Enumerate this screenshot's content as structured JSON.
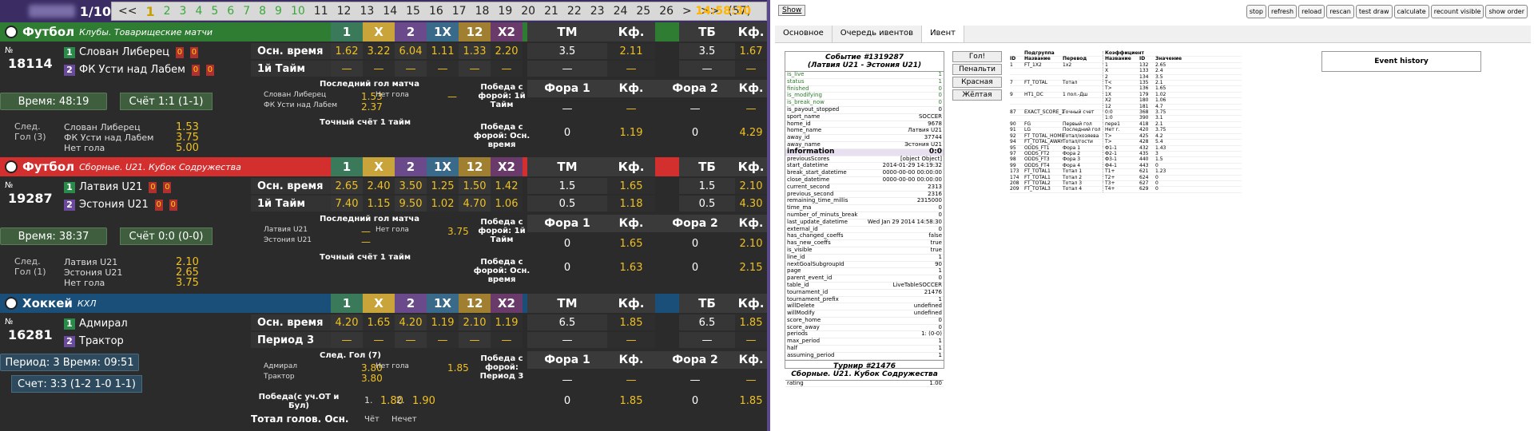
{
  "top": {
    "pager": "1/10",
    "pages": [
      "<<",
      "1",
      "2",
      "3",
      "4",
      "5",
      "6",
      "7",
      "8",
      "9",
      "10",
      "11",
      "12",
      "13",
      "14",
      "15",
      "16",
      "17",
      "18",
      "19",
      "20",
      "21",
      "22",
      "23",
      "24",
      "25",
      "26",
      ">",
      ">>",
      "(57)"
    ],
    "clock": "14:58:30"
  },
  "market_headers": [
    "1",
    "X",
    "2",
    "1X",
    "12",
    "X2",
    "ТМ",
    "Кф.",
    "ТБ",
    "Кф."
  ],
  "events": [
    {
      "sport": "Футбол",
      "league": "Клубы. Товарищеские матчи",
      "bar": "#2e7d32",
      "no": "№",
      "id": "18114",
      "team1": "Слован Либерец",
      "team2": "ФК Усти над Лабем",
      "time": "Время: 48:19",
      "score": "Счёт 1:1 (1-1)",
      "rows": [
        {
          "label": "Осн. время",
          "v": [
            "1.62",
            "3.22",
            "6.04",
            "1.11",
            "1.33",
            "2.20",
            "3.5",
            "2.11",
            "3.5",
            "1.67"
          ]
        },
        {
          "label": "1й Тайм",
          "v": [
            "—",
            "—",
            "—",
            "—",
            "—",
            "—",
            "—",
            "—",
            "—",
            "—"
          ]
        }
      ],
      "lastgoal": "Последний гол матча",
      "lg": [
        [
          "Слован Либерец",
          "1.53",
          "Нет гола",
          "—"
        ],
        [
          "ФК Усти над Лабем",
          "2.37",
          "",
          ""
        ]
      ],
      "exact": "Точный счёт 1 тайм",
      "win1": "Победа с форой: 1й Тайм",
      "win2": "Победа с форой: Осн. время",
      "fora": [
        "Фора 1",
        "Кф.",
        "Фора 2",
        "Кф."
      ],
      "f1": [
        "—",
        "—",
        "—",
        "—"
      ],
      "f2": [
        "0",
        "1.19",
        "0",
        "4.29"
      ],
      "next": "След. Гол (3)",
      "nx": [
        [
          "Слован Либерец",
          "1.53"
        ],
        [
          "ФК Усти над Лабем",
          "3.75"
        ],
        [
          "Нет гола",
          "5.00"
        ]
      ]
    },
    {
      "sport": "Футбол",
      "league": "Сборные. U21. Кубок Содружества",
      "bar": "#d32f2f",
      "no": "№",
      "id": "19287",
      "team1": "Латвия U21",
      "team2": "Эстония U21",
      "time": "Время: 38:37",
      "score": "Счёт 0:0 (0-0)",
      "rows": [
        {
          "label": "Осн. время",
          "v": [
            "2.65",
            "2.40",
            "3.50",
            "1.25",
            "1.50",
            "1.42",
            "1.5",
            "1.65",
            "1.5",
            "2.10"
          ]
        },
        {
          "label": "1й Тайм",
          "v": [
            "7.40",
            "1.15",
            "9.50",
            "1.02",
            "4.70",
            "1.06",
            "0.5",
            "1.18",
            "0.5",
            "4.30"
          ]
        }
      ],
      "lastgoal": "Последний гол матча",
      "lg": [
        [
          "Латвия U21",
          "—",
          "Нет гола",
          "3.75"
        ],
        [
          "Эстония U21",
          "—",
          "",
          ""
        ]
      ],
      "exact": "Точный счёт 1 тайм",
      "win1": "Победа с форой: 1й Тайм",
      "win2": "Победа с форой: Осн. время",
      "fora": [
        "Фора 1",
        "Кф.",
        "Фора 2",
        "Кф."
      ],
      "f1": [
        "0",
        "1.65",
        "0",
        "2.10"
      ],
      "f2": [
        "0",
        "1.63",
        "0",
        "2.15"
      ],
      "next": "След. Гол (1)",
      "nx": [
        [
          "Латвия U21",
          "2.10"
        ],
        [
          "Эстония U21",
          "2.65"
        ],
        [
          "Нет гола",
          "3.75"
        ]
      ]
    },
    {
      "sport": "Хоккей",
      "league": "КХЛ",
      "bar": "#1a4f7a",
      "no": "№",
      "id": "16281",
      "team1": "Адмирал",
      "team2": "Трактор",
      "time": "Период: 3 Время: 09:51",
      "score": "Счет: 3:3 (1-2 1-0 1-1)",
      "rows": [
        {
          "label": "Осн. время",
          "v": [
            "4.20",
            "1.65",
            "4.20",
            "1.19",
            "2.10",
            "1.19",
            "6.5",
            "1.85",
            "6.5",
            "1.85"
          ]
        },
        {
          "label": "Период 3",
          "v": [
            "—",
            "—",
            "—",
            "—",
            "—",
            "—",
            "—",
            "—",
            "—",
            "—"
          ]
        }
      ],
      "lastgoal": "След. Гол (7)",
      "lg": [
        [
          "Адмирал",
          "3.80",
          "Нет гола",
          "1.85"
        ],
        [
          "Трактор",
          "3.80",
          "",
          ""
        ]
      ],
      "win1": "Победа с форой: Период 3",
      "win2": "Победа(с уч.ОТ и Бул)",
      "fora": [
        "Фора 1",
        "Кф.",
        "Фора 2",
        "Кф."
      ],
      "f1": [
        "—",
        "—",
        "—",
        "—"
      ],
      "f2": [
        "0",
        "1.85",
        "0",
        "1.85"
      ],
      "winot": [
        "1.",
        "1.80",
        "2.",
        "1.90"
      ],
      "total": "Тотал голов. Осн.",
      "odd": "Чёт",
      "even": "Нечет"
    }
  ],
  "right": {
    "show": "Show",
    "controls": [
      "stop",
      "refresh",
      "reload",
      "rescan",
      "test draw",
      "calculate",
      "recount visible",
      "show order"
    ],
    "tabs": [
      "Основное",
      "Очередь ивентов",
      "Ивент"
    ],
    "event_title": "Событие #1319287",
    "event_sub": "(Латвия U21 - Эстония U21)",
    "fields": [
      [
        "is_live",
        "1",
        "g"
      ],
      [
        "status",
        "1",
        "g"
      ],
      [
        "finished",
        "0",
        "g"
      ],
      [
        "is_modifying",
        "0",
        "g"
      ],
      [
        "is_break_now",
        "0",
        "g"
      ],
      [
        "is_payout_stopped",
        "0",
        ""
      ],
      [
        "sport_name",
        "SOCCER",
        ""
      ],
      [
        "home_id",
        "9678",
        ""
      ],
      [
        "home_name",
        "Латвия U21",
        ""
      ],
      [
        "away_id",
        "37744",
        ""
      ],
      [
        "away_name",
        "Эстония U21",
        ""
      ],
      [
        "information",
        "0:0",
        "h"
      ],
      [
        "previousScores",
        "[object Object]",
        ""
      ],
      [
        "start_datetime",
        "2014-01-29 14:19:32",
        ""
      ],
      [
        "break_start_datetime",
        "0000-00-00 00:00:00",
        ""
      ],
      [
        "close_datetime",
        "0000-00-00 00:00:00",
        ""
      ],
      [
        "current_second",
        "2313",
        ""
      ],
      [
        "previous_second",
        "2316",
        ""
      ],
      [
        "remaining_time_millis",
        "2315000",
        ""
      ],
      [
        "time_ma",
        "0",
        ""
      ],
      [
        "number_of_minuts_break",
        "0",
        ""
      ],
      [
        "last_update_datetime",
        "Wed Jan 29 2014 14:58:30",
        ""
      ],
      [
        "external_id",
        "0",
        ""
      ],
      [
        "has_changed_coeffs",
        "false",
        ""
      ],
      [
        "has_new_coeffs",
        "true",
        ""
      ],
      [
        "is_visible",
        "true",
        ""
      ],
      [
        "line_id",
        "1",
        ""
      ],
      [
        "nextGoalSubgroupId",
        "90",
        ""
      ],
      [
        "page",
        "1",
        ""
      ],
      [
        "parent_event_id",
        "0",
        ""
      ],
      [
        "table_id",
        "LiveTableSOCCER",
        ""
      ],
      [
        "tournament_id",
        "21476",
        ""
      ],
      [
        "tournament_prefix",
        "1",
        ""
      ],
      [
        "willDelete",
        "undefined",
        ""
      ],
      [
        "willModify",
        "undefined",
        ""
      ],
      [
        "score_home",
        "0",
        ""
      ],
      [
        "score_away",
        "0",
        ""
      ],
      [
        "periods",
        "1: (0-0)",
        ""
      ],
      [
        "max_period",
        "1",
        ""
      ],
      [
        "half",
        "1",
        ""
      ],
      [
        "assuming_period",
        "1",
        ""
      ]
    ],
    "tour_title": "Турнир #21476",
    "tour_sub": "Сборные. U21. Кубок Содружества",
    "rating": [
      "rating",
      "1.00"
    ],
    "actions": [
      "Гол!",
      "Пенальти",
      "Красная",
      "Жёлтая"
    ],
    "coef_head": [
      "ID",
      "Название",
      "Перевод",
      "Название",
      "ID",
      "Значение"
    ],
    "coef_groups": [
      "Подгруппа",
      "Коэффициент"
    ],
    "coefs": [
      [
        "1",
        "FT_1X2",
        "1х2",
        "1",
        "132",
        "2.65"
      ],
      [
        "",
        "",
        "",
        "X",
        "133",
        "2.4"
      ],
      [
        "",
        "",
        "",
        "2",
        "134",
        "3.5"
      ],
      [
        "7",
        "FT_TOTAL",
        "Тотал",
        "T<",
        "135",
        "2.1"
      ],
      [
        "",
        "",
        "",
        "T>",
        "136",
        "1.65"
      ],
      [
        "9",
        "HT1_DC",
        "1 пол.-Дш",
        "1X",
        "179",
        "1.02"
      ],
      [
        "",
        "",
        "",
        "X2",
        "180",
        "1.06"
      ],
      [
        "",
        "",
        "",
        "12",
        "181",
        "4.7"
      ],
      [
        "87",
        "EXACT_SCORE_1",
        "Точный счет",
        "0:0",
        "368",
        "3.75"
      ],
      [
        "",
        "",
        "",
        "1:0",
        "390",
        "3.1"
      ],
      [
        "90",
        "FG",
        "Первый гол",
        "пере1",
        "418",
        "2.1"
      ],
      [
        "91",
        "LG",
        "Последний гол",
        "Нет г.",
        "420",
        "3.75"
      ],
      [
        "92",
        "FT_TOTAL_HOME",
        "Тотал/хозяева",
        "T>",
        "425",
        "4.2"
      ],
      [
        "94",
        "FT_TOTAL_AWAY",
        "Тотал/гости",
        "T>",
        "428",
        "5.4"
      ],
      [
        "95",
        "ODDS_FT1",
        "Фора 1",
        "Ф1-1",
        "432",
        "1.43"
      ],
      [
        "97",
        "ODDS_FT2",
        "Фора 2",
        "Ф2-1",
        "435",
        "3"
      ],
      [
        "98",
        "ODDS_FT3",
        "Фора 3",
        "Ф3-1",
        "440",
        "1.5"
      ],
      [
        "99",
        "ODDS_FT4",
        "Фора 4",
        "Ф4-1",
        "443",
        "0"
      ],
      [
        "173",
        "FT_TOTAL1",
        "Тотал 1",
        "T1+",
        "621",
        "1.23"
      ],
      [
        "174",
        "FT_TOTAL1",
        "Тотал 2",
        "T2+",
        "624",
        "0"
      ],
      [
        "208",
        "FT_TOTAL2",
        "Тотал 3",
        "T3+",
        "627",
        "0"
      ],
      [
        "209",
        "FT_TOTAL3",
        "Тотал 4",
        "T4+",
        "629",
        "0"
      ]
    ],
    "history": "Event history"
  }
}
